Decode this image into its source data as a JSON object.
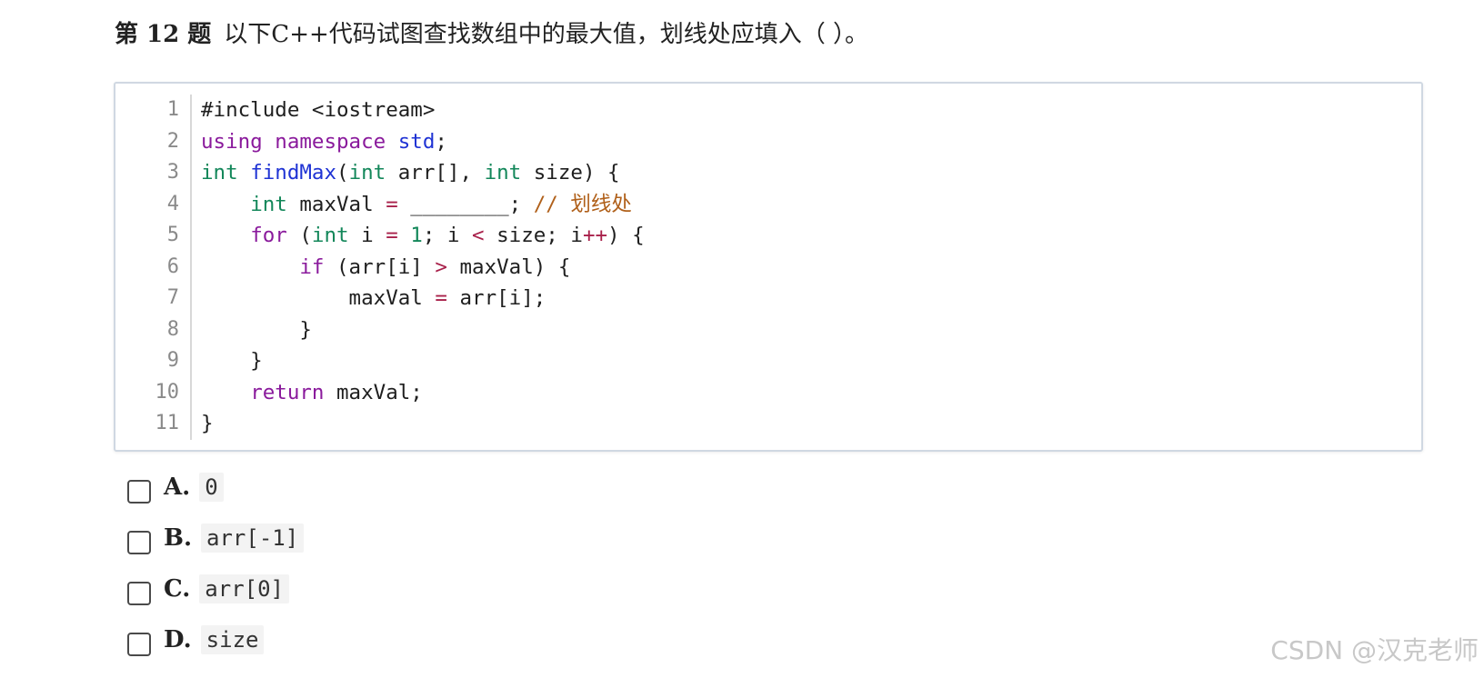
{
  "question": {
    "number": "第 12 题",
    "text": "以下C++代码试图查找数组中的最大值，划线处应填入（ ）。"
  },
  "code": {
    "line_numbers": [
      "1",
      "2",
      "3",
      "4",
      "5",
      "6",
      "7",
      "8",
      "9",
      "10",
      "11"
    ],
    "lines": [
      [
        {
          "t": "#include <iostream>",
          "c": "plain"
        }
      ],
      [
        {
          "t": "using",
          "c": "kw"
        },
        {
          "t": " ",
          "c": "plain"
        },
        {
          "t": "namespace",
          "c": "kw"
        },
        {
          "t": " ",
          "c": "plain"
        },
        {
          "t": "std",
          "c": "ns"
        },
        {
          "t": ";",
          "c": "plain"
        }
      ],
      [
        {
          "t": "int",
          "c": "ty"
        },
        {
          "t": " ",
          "c": "plain"
        },
        {
          "t": "findMax",
          "c": "fn"
        },
        {
          "t": "(",
          "c": "plain"
        },
        {
          "t": "int",
          "c": "ty"
        },
        {
          "t": " arr[], ",
          "c": "plain"
        },
        {
          "t": "int",
          "c": "ty"
        },
        {
          "t": " size) {",
          "c": "plain"
        }
      ],
      [
        {
          "t": "    ",
          "c": "plain"
        },
        {
          "t": "int",
          "c": "ty"
        },
        {
          "t": " maxVal ",
          "c": "plain"
        },
        {
          "t": "=",
          "c": "op"
        },
        {
          "t": " ________; ",
          "c": "plain"
        },
        {
          "t": "// 划线处",
          "c": "cm"
        }
      ],
      [
        {
          "t": "    ",
          "c": "plain"
        },
        {
          "t": "for",
          "c": "kw"
        },
        {
          "t": " (",
          "c": "plain"
        },
        {
          "t": "int",
          "c": "ty"
        },
        {
          "t": " i ",
          "c": "plain"
        },
        {
          "t": "=",
          "c": "op"
        },
        {
          "t": " ",
          "c": "plain"
        },
        {
          "t": "1",
          "c": "num"
        },
        {
          "t": "; i ",
          "c": "plain"
        },
        {
          "t": "<",
          "c": "op"
        },
        {
          "t": " size; i",
          "c": "plain"
        },
        {
          "t": "++",
          "c": "op"
        },
        {
          "t": ") {",
          "c": "plain"
        }
      ],
      [
        {
          "t": "        ",
          "c": "plain"
        },
        {
          "t": "if",
          "c": "kw"
        },
        {
          "t": " (arr[i] ",
          "c": "plain"
        },
        {
          "t": ">",
          "c": "op"
        },
        {
          "t": " maxVal) {",
          "c": "plain"
        }
      ],
      [
        {
          "t": "            maxVal ",
          "c": "plain"
        },
        {
          "t": "=",
          "c": "op"
        },
        {
          "t": " arr[i];",
          "c": "plain"
        }
      ],
      [
        {
          "t": "        }",
          "c": "plain"
        }
      ],
      [
        {
          "t": "    }",
          "c": "plain"
        }
      ],
      [
        {
          "t": "    ",
          "c": "plain"
        },
        {
          "t": "return",
          "c": "kw"
        },
        {
          "t": " maxVal;",
          "c": "plain"
        }
      ],
      [
        {
          "t": "}",
          "c": "plain"
        }
      ]
    ]
  },
  "options": [
    {
      "letter": "A.",
      "value": "0"
    },
    {
      "letter": "B.",
      "value": "arr[-1]"
    },
    {
      "letter": "C.",
      "value": "arr[0]"
    },
    {
      "letter": "D.",
      "value": "size"
    }
  ],
  "watermark": "CSDN @汉克老师"
}
